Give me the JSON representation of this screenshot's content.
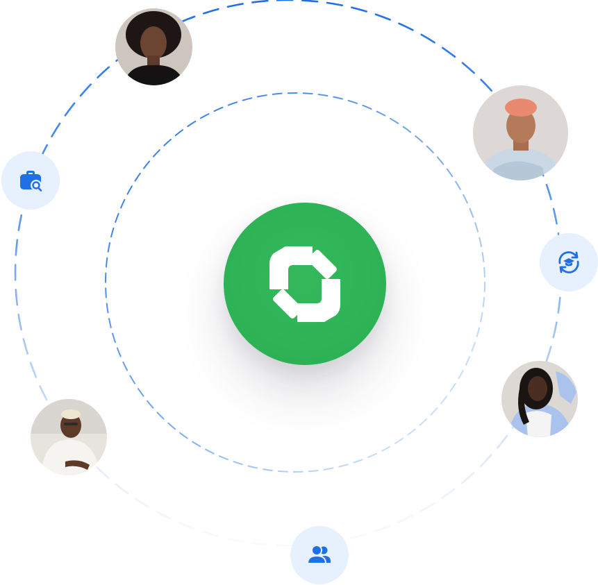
{
  "colors": {
    "accent_blue": "#1f6fe5",
    "badge_bg": "#e7f0fd",
    "brand_green": "#2eb356",
    "logo_white": "#ffffff"
  },
  "center_logo": {
    "icon": "brand-logo-icon"
  },
  "orbit_badges": [
    {
      "icon": "briefcase-search-icon"
    },
    {
      "icon": "graduation-cap-refresh-icon"
    },
    {
      "icon": "users-icon"
    }
  ],
  "avatars": [
    {
      "icon": "avatar-woman-black-top"
    },
    {
      "icon": "avatar-man-orange-hair"
    },
    {
      "icon": "avatar-woman-white-shirt"
    },
    {
      "icon": "avatar-woman-braids"
    }
  ]
}
